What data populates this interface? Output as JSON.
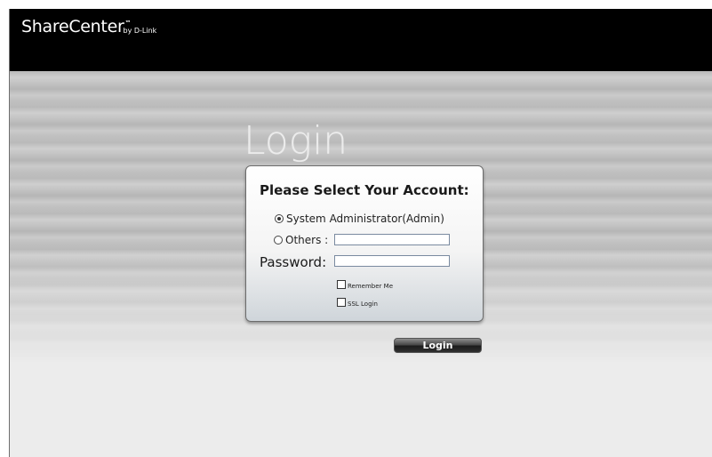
{
  "brand": {
    "name": "ShareCenter",
    "tm": "™",
    "by": "by D-Link"
  },
  "page": {
    "title": "Login"
  },
  "login_form": {
    "heading": "Please Select Your Account:",
    "options": [
      {
        "label": "System Administrator(Admin)",
        "selected": true
      },
      {
        "label": "Others :",
        "selected": false
      }
    ],
    "others_value": "",
    "password_label": "Password:",
    "password_value": "",
    "remember_me_label": "Remember Me",
    "remember_me_checked": false,
    "ssl_login_label": "SSL Login",
    "ssl_login_checked": false,
    "submit_label": "Login"
  },
  "colors": {
    "topbar": "#000000",
    "button": "#2a2a2a"
  }
}
